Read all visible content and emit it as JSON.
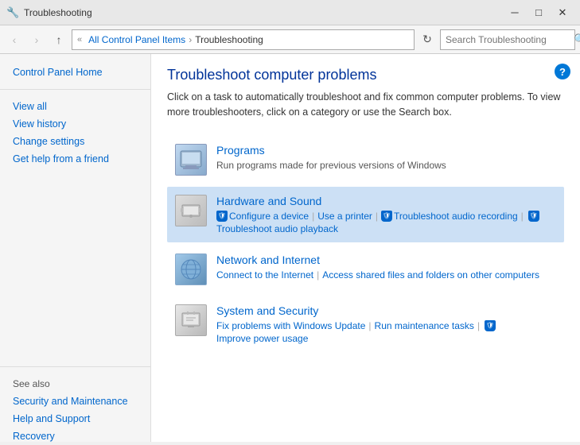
{
  "titlebar": {
    "icon": "🔧",
    "title": "Troubleshooting",
    "minimize": "─",
    "maximize": "□",
    "close": "✕"
  },
  "addressbar": {
    "back": "‹",
    "forward": "›",
    "up": "↑",
    "path_root": "All Control Panel Items",
    "path_current": "Troubleshooting",
    "search_placeholder": "Search Troubleshooting",
    "search_icon": "🔍"
  },
  "sidebar": {
    "main_link": "Control Panel Home",
    "links": [
      "View all",
      "View history",
      "Change settings",
      "Get help from a friend"
    ],
    "see_also_title": "See also",
    "see_also_links": [
      "Security and Maintenance",
      "Help and Support",
      "Recovery"
    ]
  },
  "content": {
    "title": "Troubleshoot computer problems",
    "description": "Click on a task to automatically troubleshoot and fix common computer problems. To view more troubleshooters, click on a category or use the Search box.",
    "help_icon": "?",
    "categories": [
      {
        "name": "Programs",
        "description": "Run programs made for previous versions of Windows",
        "links": [],
        "icon_type": "programs",
        "highlighted": false
      },
      {
        "name": "Hardware and Sound",
        "description": "",
        "links": [
          "Configure a device",
          "Use a printer",
          "Troubleshoot audio recording",
          "Troubleshoot audio playback"
        ],
        "icon_type": "hardware",
        "highlighted": true
      },
      {
        "name": "Network and Internet",
        "description": "",
        "links": [
          "Connect to the Internet",
          "Access shared files and folders on other computers"
        ],
        "icon_type": "network",
        "highlighted": false
      },
      {
        "name": "System and Security",
        "description": "",
        "links": [
          "Fix problems with Windows Update",
          "Run maintenance tasks",
          "Improve power usage"
        ],
        "icon_type": "system",
        "highlighted": false
      }
    ]
  }
}
